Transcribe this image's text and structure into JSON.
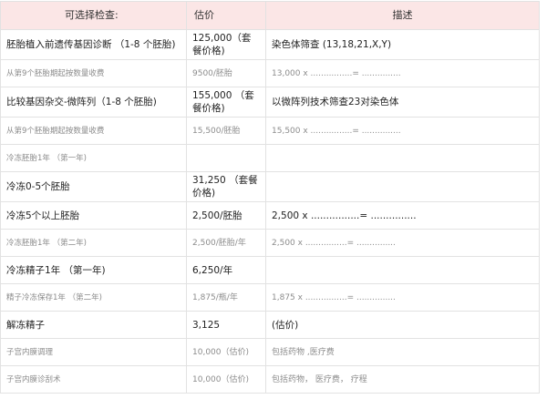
{
  "table": {
    "headers": {
      "item": "可选择检查:",
      "price": "估价",
      "desc": "描述"
    },
    "rows": [
      {
        "item": "胚胎植入前遗传基因诊断 （1-8 个胚胎)",
        "price": "125,000（套餐价格)",
        "desc": "染色体筛查 (13,18,21,X,Y)",
        "style": "main"
      },
      {
        "item": "从第9个胚胎期起按数量收费",
        "price": "9500/胚胎",
        "desc": "13,000 x ................= ...............",
        "style": "sub"
      },
      {
        "item": "比较基因杂交-微阵列（1-8 个胚胎)",
        "price": "155,000 （套餐价格)",
        "desc": "以微阵列技术筛查23对染色体",
        "style": "main"
      },
      {
        "item": "从第9个胚胎期起按数量收费",
        "price": "15,500/胚胎",
        "desc": "15,500 x ................= ...............",
        "style": "sub"
      },
      {
        "item": "冷冻胚胎1年 （第一年)",
        "price": "",
        "desc": "",
        "style": "sub"
      },
      {
        "item": "冷冻0-5个胚胎",
        "price": "31,250 （套餐价格)",
        "desc": "",
        "style": "main"
      },
      {
        "item": "冷冻5个以上胚胎",
        "price": "2,500/胚胎",
        "desc": "2,500 x ................= ...............",
        "style": "main"
      },
      {
        "item": "冷冻胚胎1年 （第二年)",
        "price": "2,500/胚胎/年",
        "desc": "2,500 x ................= ...............",
        "style": "sub"
      },
      {
        "item": "冷冻精子1年 （第一年)",
        "price": "6,250/年",
        "desc": "",
        "style": "main"
      },
      {
        "item": "精子冷冻保存1年 （第二年)",
        "price": "1,875/瓶/年",
        "desc": "1,875 x ................= ...............",
        "style": "sub"
      },
      {
        "item": "解冻精子",
        "price": "3,125",
        "desc": "(估价)",
        "style": "main"
      },
      {
        "item": "子宫内膜调理",
        "price": "10,000（估价)",
        "desc": "包括药物 ,医疗费",
        "style": "sub"
      },
      {
        "item": "子宫内膜诊刮术",
        "price": "10,000（估价)",
        "desc": "包括药物， 医疗费， 疗程",
        "style": "sub"
      }
    ]
  }
}
